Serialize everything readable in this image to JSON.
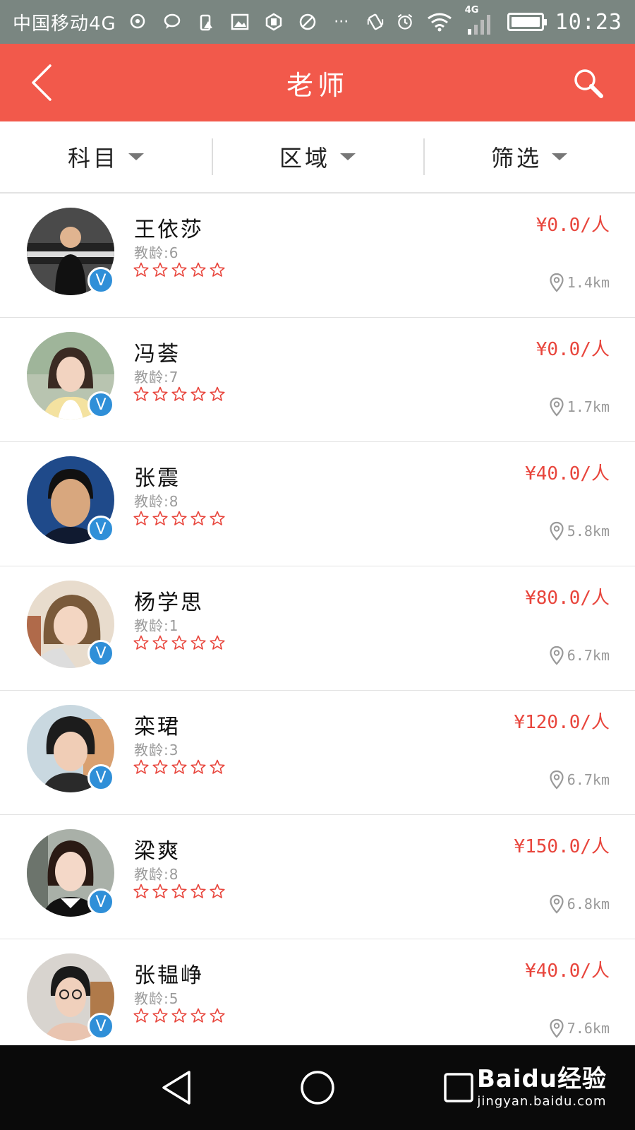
{
  "status_bar": {
    "carrier": "中国移动4G",
    "time": "10:23",
    "network": "4G",
    "more": "···"
  },
  "header": {
    "title": "老师"
  },
  "filters": [
    {
      "label": "科目"
    },
    {
      "label": "区域"
    },
    {
      "label": "筛选"
    }
  ],
  "teachers": [
    {
      "name": "王依莎",
      "age": "教龄:6",
      "price": "¥0.0/人",
      "distance": "1.4km",
      "rating": 0,
      "rating_max": 5
    },
    {
      "name": "冯荟",
      "age": "教龄:7",
      "price": "¥0.0/人",
      "distance": "1.7km",
      "rating": 0,
      "rating_max": 5
    },
    {
      "name": "张震",
      "age": "教龄:8",
      "price": "¥40.0/人",
      "distance": "5.8km",
      "rating": 0,
      "rating_max": 5
    },
    {
      "name": "杨学思",
      "age": "教龄:1",
      "price": "¥80.0/人",
      "distance": "6.7km",
      "rating": 0,
      "rating_max": 5
    },
    {
      "name": "栾珺",
      "age": "教龄:3",
      "price": "¥120.0/人",
      "distance": "6.7km",
      "rating": 0,
      "rating_max": 5
    },
    {
      "name": "梁爽",
      "age": "教龄:8",
      "price": "¥150.0/人",
      "distance": "6.8km",
      "rating": 0,
      "rating_max": 5
    },
    {
      "name": "张韫峥",
      "age": "教龄:5",
      "price": "¥40.0/人",
      "distance": "7.6km",
      "rating": 0,
      "rating_max": 5
    }
  ],
  "badge_text": "V",
  "watermark": {
    "logo": "Baidu经验",
    "url": "jingyan.baidu.com"
  },
  "colors": {
    "brand": "#f2594b",
    "price": "#e8453c",
    "badge": "#2f8fd8",
    "status_bar": "#7a8681"
  }
}
